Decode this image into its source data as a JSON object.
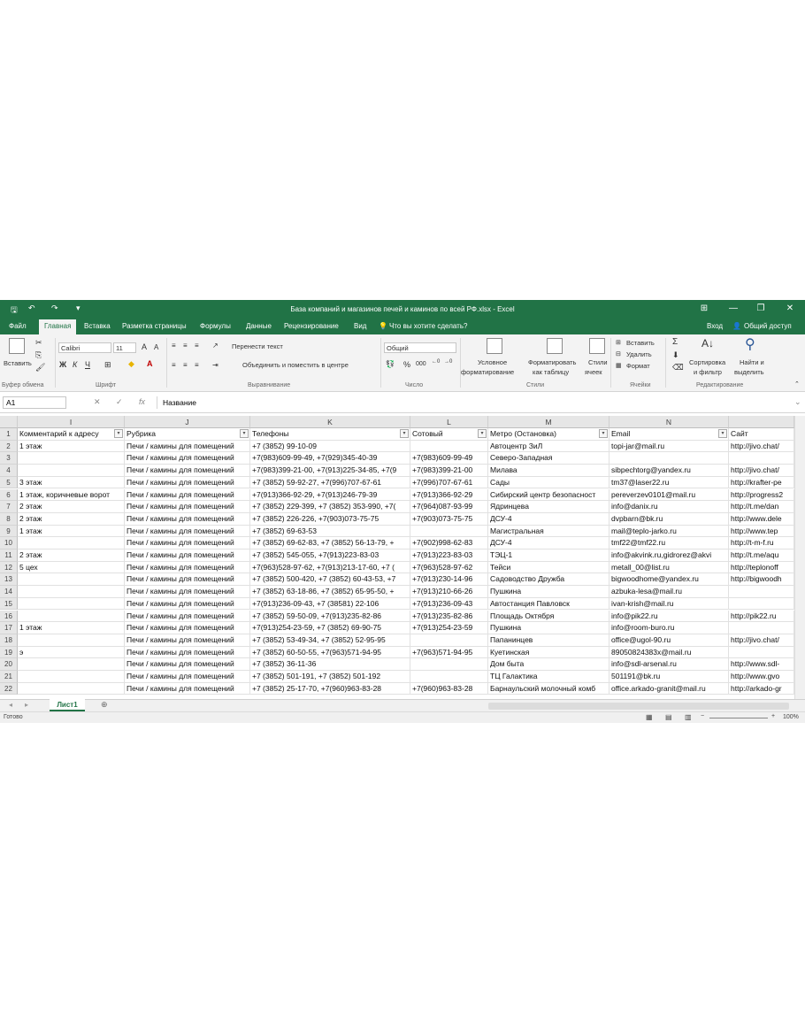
{
  "window": {
    "title": "База компаний и магазинов печей и каминов по всей РФ.xlsx - Excel",
    "buttons": [
      "⊞",
      "—",
      "❐",
      "✕"
    ]
  },
  "tabs": [
    "Файл",
    "Главная",
    "Вставка",
    "Разметка страницы",
    "Формулы",
    "Данные",
    "Рецензирование",
    "Вид"
  ],
  "tell_me": "Что вы хотите сделать?",
  "signin": "Вход",
  "share": "Общий доступ",
  "ribbon": {
    "paste": "Вставить",
    "clipboard": "Буфер обмена",
    "font_name": "Calibri",
    "font_size": "11",
    "bold": "Ж",
    "italic": "К",
    "underline": "Ч",
    "font_group": "Шрифт",
    "wrap_text": "Перенести текст",
    "merge_center": "Объединить и поместить в центре",
    "alignment_group": "Выравнивание",
    "number_format": "Общий",
    "number_group": "Число",
    "cond_format_1": "Условное",
    "cond_format_2": "форматирование",
    "format_table_1": "Форматировать",
    "format_table_2": "как таблицу",
    "cell_styles_1": "Стили",
    "cell_styles_2": "ячеек",
    "styles_group": "Стили",
    "insert": "Вставить",
    "delete": "Удалить",
    "format": "Формат",
    "cells_group": "Ячейки",
    "sort_1": "Сортировка",
    "sort_2": "и фильтр",
    "find_1": "Найти и",
    "find_2": "выделить",
    "editing_group": "Редактирование"
  },
  "formula_bar": {
    "cell_ref": "A1",
    "fx": "fx",
    "value": "Название"
  },
  "columns": [
    "I",
    "J",
    "K",
    "L",
    "M",
    "N",
    ""
  ],
  "header_row": [
    "Комментарий к адресу",
    "Рубрика",
    "Телефоны",
    "Сотовый",
    "Метро (Остановка)",
    "Email",
    "Сайт"
  ],
  "row_numbers": [
    "1",
    "2",
    "3",
    "4",
    "5",
    "6",
    "7",
    "8",
    "9",
    "10",
    "11",
    "12",
    "13",
    "14",
    "15",
    "16",
    "17",
    "18",
    "19",
    "20",
    "21",
    "22"
  ],
  "rows": [
    [
      "1 этаж",
      "Печи / камины для помещений",
      "+7 (3852) 99-10-09",
      "",
      "Автоцентр ЗиЛ",
      "topi-jar@mail.ru",
      "http://jivo.chat/"
    ],
    [
      "",
      "Печи / камины для помещений",
      "+7(983)609-99-49, +7(929)345-40-39",
      "+7(983)609-99-49",
      "Северо-Западная",
      "",
      ""
    ],
    [
      "",
      "Печи / камины для помещений",
      "+7(983)399-21-00, +7(913)225-34-85, +7(9",
      "+7(983)399-21-00",
      "Милава",
      "sibpechtorg@yandex.ru",
      "http://jivo.chat/"
    ],
    [
      "3 этаж",
      "Печи / камины для помещений",
      "+7 (3852) 59-92-27, +7(996)707-67-61",
      "+7(996)707-67-61",
      "Сады",
      "tm37@laser22.ru",
      "http://krafter-pe"
    ],
    [
      "1 этаж, коричневые ворот",
      "Печи / камины для помещений",
      "+7(913)366-92-29, +7(913)246-79-39",
      "+7(913)366-92-29",
      "Сибирский центр безопасност",
      "pereverzev0101@mail.ru",
      "http://progress2"
    ],
    [
      "2 этаж",
      "Печи / камины для помещений",
      "+7 (3852) 229-399, +7 (3852) 353-990, +7(",
      "+7(964)087-93-99",
      "Ядринцева",
      "info@danix.ru",
      "http://t.me/dan"
    ],
    [
      "2 этаж",
      "Печи / камины для помещений",
      "+7 (3852) 226-226, +7(903)073-75-75",
      "+7(903)073-75-75",
      "ДСУ-4",
      "dvpbarn@bk.ru",
      "http://www.dele"
    ],
    [
      "1 этаж",
      "Печи / камины для помещений",
      "+7 (3852) 69-63-53",
      "",
      "Магистральная",
      "mail@teplo-jarko.ru",
      "http://www.tep"
    ],
    [
      "",
      "Печи / камины для помещений",
      "+7 (3852) 69-62-83, +7 (3852) 56-13-79, +",
      "+7(902)998-62-83",
      "ДСУ-4",
      "tmf22@tmf22.ru",
      "http://t-m-f.ru"
    ],
    [
      "2 этаж",
      "Печи / камины для помещений",
      "+7 (3852) 545-055, +7(913)223-83-03",
      "+7(913)223-83-03",
      "ТЭЦ-1",
      "info@akvink.ru,gidrorez@akvi",
      "http://t.me/aqu"
    ],
    [
      "5 цех",
      "Печи / камины для помещений",
      "+7(963)528-97-62, +7(913)213-17-60, +7 (",
      "+7(963)528-97-62",
      "Тейси",
      "metall_00@list.ru",
      "http://teplonoff"
    ],
    [
      "",
      "Печи / камины для помещений",
      "+7 (3852) 500-420, +7 (3852) 60-43-53, +7",
      "+7(913)230-14-96",
      "Садоводство Дружба",
      "bigwoodhome@yandex.ru",
      "http://bigwoodh"
    ],
    [
      "",
      "Печи / камины для помещений",
      "+7 (3852) 63-18-86, +7 (3852) 65-95-50, +",
      "+7(913)210-66-26",
      "Пушкина",
      "azbuka-lesa@mail.ru",
      ""
    ],
    [
      "",
      "Печи / камины для помещений",
      "+7(913)236-09-43, +7 (38581) 22-106",
      "+7(913)236-09-43",
      "Автостанция Павловск",
      "ivan-krish@mail.ru",
      ""
    ],
    [
      "",
      "Печи / камины для помещений",
      "+7 (3852) 59-50-09, +7(913)235-82-86",
      "+7(913)235-82-86",
      "Площадь Октября",
      "info@pik22.ru",
      "http://pik22.ru"
    ],
    [
      "1 этаж",
      "Печи / камины для помещений",
      "+7(913)254-23-59, +7 (3852) 69-90-75",
      "+7(913)254-23-59",
      "Пушкина",
      "info@room-buro.ru",
      ""
    ],
    [
      "",
      "Печи / камины для помещений",
      "+7 (3852) 53-49-34, +7 (3852) 52-95-95",
      "",
      "Папанинцев",
      "office@ugol-90.ru",
      "http://jivo.chat/"
    ],
    [
      "э",
      "Печи / камины для помещений",
      "+7 (3852) 60-50-55, +7(963)571-94-95",
      "+7(963)571-94-95",
      "Куетинская",
      "89050824383x@mail.ru",
      ""
    ],
    [
      "",
      "Печи / камины для помещений",
      "+7 (3852) 36-11-36",
      "",
      "Дом быта",
      "info@sdl-arsenal.ru",
      "http://www.sdl-"
    ],
    [
      "",
      "Печи / камины для помещений",
      "+7 (3852) 501-191, +7 (3852) 501-192",
      "",
      "ТЦ Галактика",
      "501191@bk.ru",
      "http://www.gvo"
    ],
    [
      "",
      "Печи / камины для помещений",
      "+7 (3852) 25-17-70, +7(960)963-83-28",
      "+7(960)963-83-28",
      "Барнаульский молочный комб",
      "office.arkado-granit@mail.ru",
      "http://arkado-gr"
    ]
  ],
  "sheet_tab": "Лист1",
  "status": {
    "ready": "Готово",
    "zoom": "100%"
  },
  "colors": {
    "accent": "#217346"
  }
}
